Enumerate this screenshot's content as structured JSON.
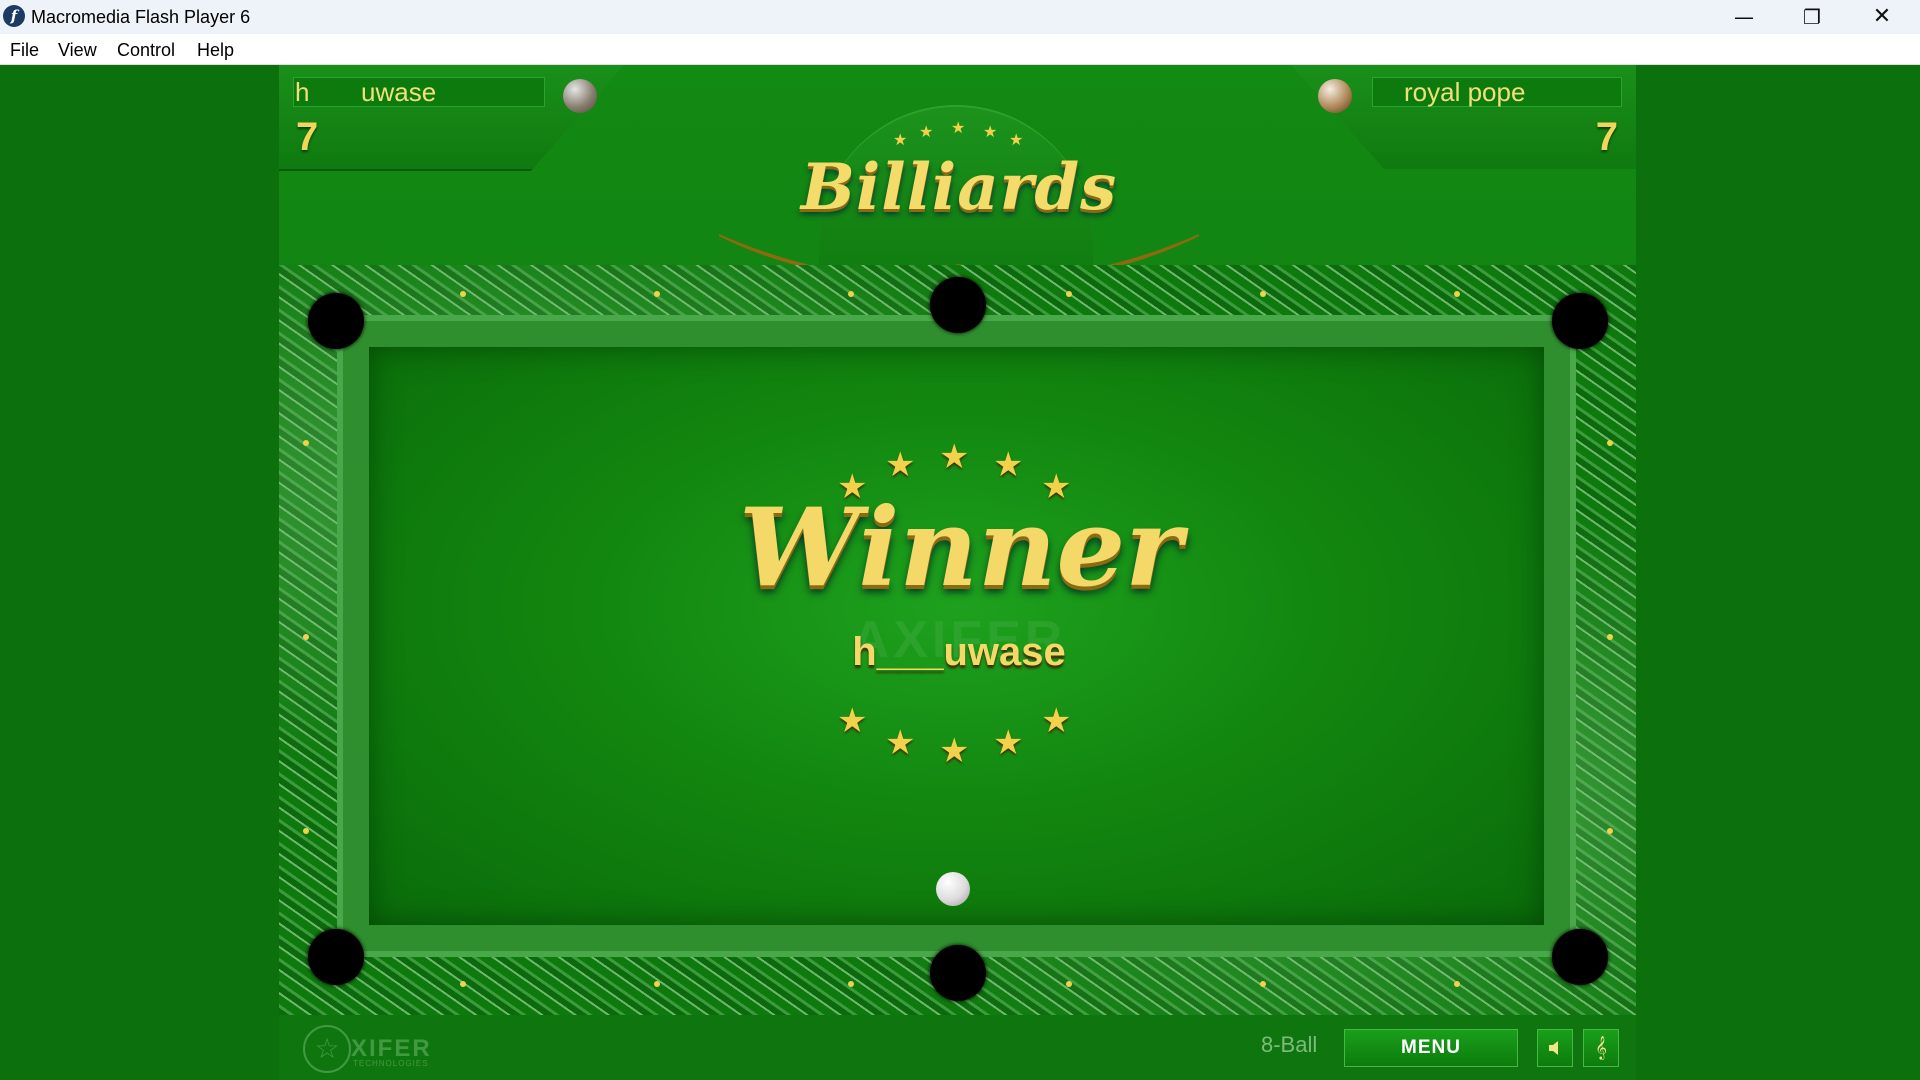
{
  "window": {
    "title": "Macromedia Flash Player 6",
    "controls": {
      "minimize": "—",
      "maximize": "❐",
      "close": "✕"
    }
  },
  "menubar": {
    "items": [
      "File",
      "View",
      "Control",
      "Help"
    ]
  },
  "game": {
    "logo": "Billiards",
    "player1": {
      "name_initial": "h",
      "name_rest": "uwase",
      "score": "7",
      "ball_icon": "grey-ball-icon"
    },
    "player2": {
      "name": "royal pope",
      "score": "7",
      "ball_icon": "brown-ball-icon"
    },
    "winner": {
      "title": "Winner",
      "name": "h___uwase"
    },
    "watermark": "AXIFER",
    "mode": "8-Ball",
    "menu_button": "MENU",
    "brand": {
      "name": "XIFER",
      "sub": "TECHNOLOGIES"
    },
    "icons": {
      "sound": "speaker-icon",
      "music": "treble-clef-icon"
    },
    "colors": {
      "felt": "#12860f",
      "gold": "#f4d968",
      "stage": "#0c700c"
    }
  }
}
